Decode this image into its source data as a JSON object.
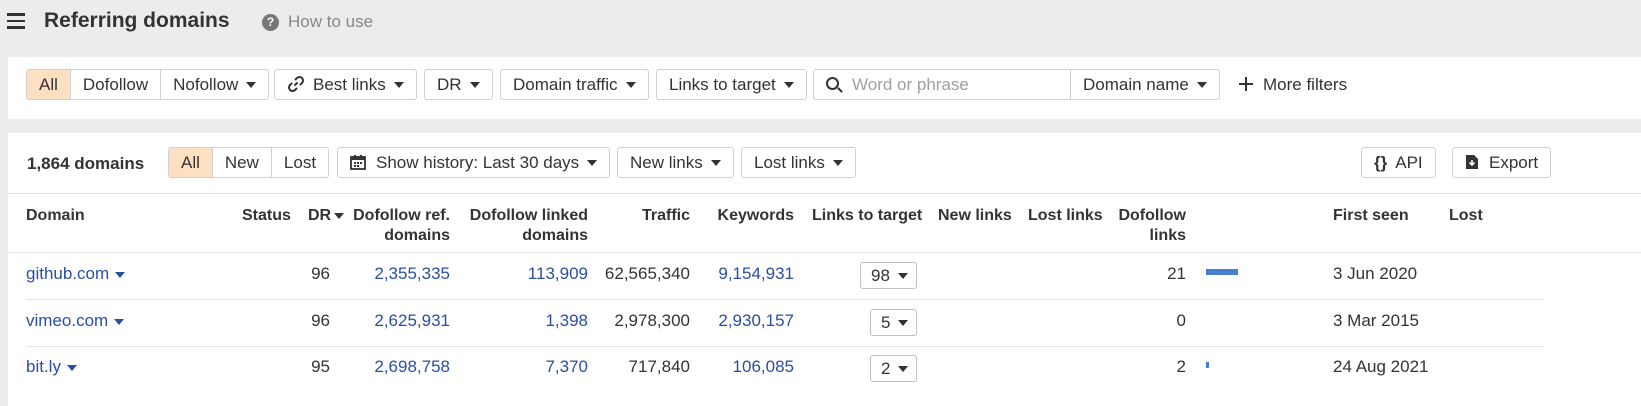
{
  "header": {
    "title": "Referring domains",
    "help_icon": "?",
    "help_label": "How to use"
  },
  "filters": {
    "link_type": [
      "All",
      "Dofollow",
      "Nofollow"
    ],
    "best_links": "Best links",
    "dr": "DR",
    "domain_traffic": "Domain traffic",
    "links_to_target": "Links to target",
    "search_placeholder": "Word or phrase",
    "search_value": "",
    "search_scope": "Domain name",
    "more_filters": "More filters"
  },
  "toolbar": {
    "count": "1,864 domains",
    "status_tabs": [
      "All",
      "New",
      "Lost"
    ],
    "history": "Show history: Last 30 days",
    "new_links": "New links",
    "lost_links": "Lost links",
    "api_icon": "{}",
    "api": "API",
    "export": "Export"
  },
  "table": {
    "headers": {
      "domain": "Domain",
      "status": "Status",
      "dr": "DR",
      "dofollow_ref_1": "Dofollow ref.",
      "dofollow_ref_2": "domains",
      "dofollow_linked_1": "Dofollow linked",
      "dofollow_linked_2": "domains",
      "traffic": "Traffic",
      "keywords": "Keywords",
      "links_to_target": "Links to target",
      "new_links": "New links",
      "lost_links": "Lost links",
      "dofollow_links_1": "Dofollow",
      "dofollow_links_2": "links",
      "first_seen": "First seen",
      "lost": "Lost"
    },
    "rows": [
      {
        "domain": "github.com",
        "dr": "96",
        "dofollow_ref": "2,355,335",
        "dofollow_linked": "113,909",
        "traffic": "62,565,340",
        "keywords": "9,154,931",
        "links_to_target": "98",
        "dofollow_links": "21",
        "dofollow_share": 1.0,
        "first_seen": "3 Jun 2020"
      },
      {
        "domain": "vimeo.com",
        "dr": "96",
        "dofollow_ref": "2,625,931",
        "dofollow_linked": "1,398",
        "traffic": "2,978,300",
        "keywords": "2,930,157",
        "links_to_target": "5",
        "dofollow_links": "0",
        "dofollow_share": 0.0,
        "first_seen": "3 Mar 2015"
      },
      {
        "domain": "bit.ly",
        "dr": "95",
        "dofollow_ref": "2,698,758",
        "dofollow_linked": "7,370",
        "traffic": "717,840",
        "keywords": "106,085",
        "links_to_target": "2",
        "dofollow_links": "2",
        "dofollow_share": 0.1,
        "first_seen": "24 Aug 2021"
      }
    ]
  },
  "colors": {
    "accent_active": "#fde0c2",
    "link": "#2b4ea2",
    "bar": "#4a7fcf",
    "background": "#ebecee"
  }
}
